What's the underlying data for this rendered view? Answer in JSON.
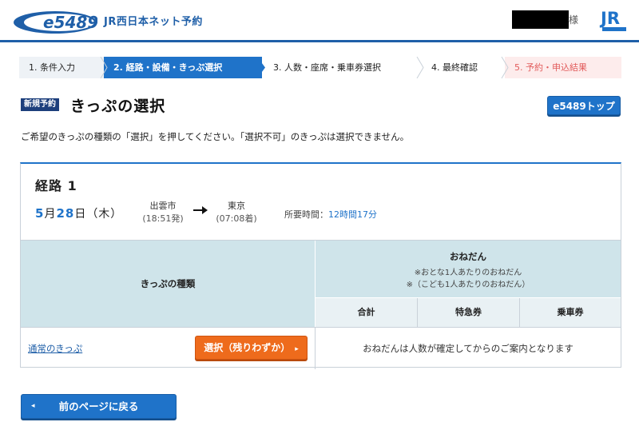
{
  "header": {
    "logo_text": "e5489",
    "site_name": "JR西日本ネット予約",
    "user_suffix": "様",
    "brand_color": "#1f5fa8"
  },
  "steps": [
    {
      "label": "1. 条件入力",
      "state": "done"
    },
    {
      "label": "2. 経路・設備・きっぷ選択",
      "state": "active"
    },
    {
      "label": "3. 人数・座席・乗車券選択",
      "state": "todo"
    },
    {
      "label": "4. 最終確認",
      "state": "todo"
    },
    {
      "label": "5. 予約・申込結果",
      "state": "result"
    }
  ],
  "title_row": {
    "badge": "新規予約",
    "title": "きっぷの選択",
    "top_button": "e5489トップ"
  },
  "instruction": "ご希望のきっぷの種類の「選択」を押してください。「選択不可」のきっぷは選択できません。",
  "route": {
    "title": "経路 1",
    "month": "5",
    "month_unit": "月",
    "day": "28",
    "day_unit": "日",
    "weekday": "（木）",
    "from_station": "出雲市",
    "from_time": "(18:51発)",
    "to_station": "東京",
    "to_time": "(07:08着)",
    "duration_label": "所要時間：",
    "duration_value": "12時間17分"
  },
  "table": {
    "type_header": "きっぷの種類",
    "price_header": "おねだん",
    "price_note_adult": "※おとな1人あたりのおねだん",
    "price_note_child": "※（こども1人あたりのおねだん）",
    "sub_headers": [
      "合計",
      "特急券",
      "乗車券"
    ],
    "rows": [
      {
        "ticket": "通常のきっぷ",
        "button": "選択（残りわずか）",
        "price_message": "おねだんは人数が確定してからのご案内となります"
      }
    ]
  },
  "back_button": "前のページに戻る",
  "colors": {
    "accent": "#1f73c9",
    "orange": "#ee6b1c",
    "header_bg": "#cfe4ea"
  }
}
